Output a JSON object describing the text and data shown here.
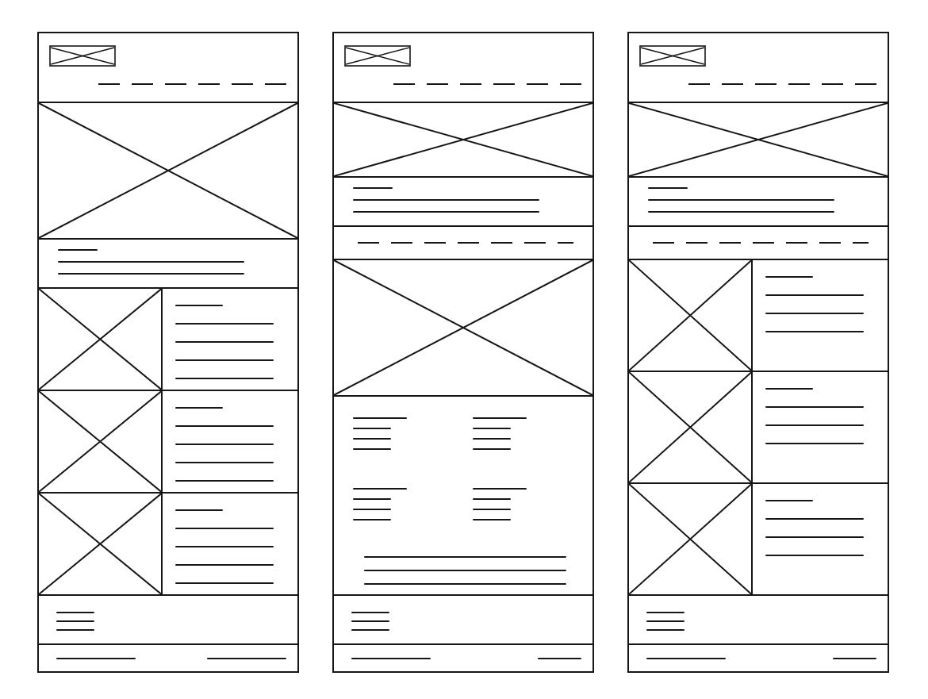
{
  "panels": [
    {
      "sections": [
        {
          "kind": "header"
        },
        {
          "kind": "hero"
        },
        {
          "kind": "text",
          "lines": [
            {
              "kind": "short"
            },
            {
              "kind": "long"
            },
            {
              "kind": "long"
            }
          ]
        },
        {
          "kind": "media",
          "lines": [
            {
              "kind": "short"
            },
            {
              "kind": "long"
            },
            {
              "kind": "long"
            },
            {
              "kind": "long"
            },
            {
              "kind": "long"
            }
          ]
        },
        {
          "kind": "media",
          "lines": [
            {
              "kind": "short"
            },
            {
              "kind": "long"
            },
            {
              "kind": "long"
            },
            {
              "kind": "long"
            },
            {
              "kind": "long"
            }
          ]
        },
        {
          "kind": "media",
          "lines": [
            {
              "kind": "short"
            },
            {
              "kind": "long"
            },
            {
              "kind": "long"
            },
            {
              "kind": "long"
            },
            {
              "kind": "long"
            }
          ]
        },
        {
          "kind": "footer",
          "lines": [
            {
              "kind": "short"
            },
            {
              "kind": "short"
            },
            {
              "kind": "short"
            }
          ]
        },
        {
          "kind": "bottom-bar",
          "lines": [
            {
              "kind": "long"
            },
            {
              "kind": "long"
            }
          ]
        }
      ]
    },
    {
      "sections": [
        {
          "kind": "header"
        },
        {
          "kind": "banner"
        },
        {
          "kind": "text",
          "lines": [
            {
              "kind": "short"
            },
            {
              "kind": "long"
            },
            {
              "kind": "long"
            }
          ]
        },
        {
          "kind": "nav"
        },
        {
          "kind": "hero"
        },
        {
          "kind": "columns",
          "groups": [
            {
              "lines": [
                {
                  "kind": "long"
                },
                {
                  "kind": "short"
                },
                {
                  "kind": "short"
                },
                {
                  "kind": "short"
                }
              ]
            },
            {
              "lines": [
                {
                  "kind": "long"
                },
                {
                  "kind": "short"
                },
                {
                  "kind": "short"
                },
                {
                  "kind": "short"
                }
              ]
            },
            {
              "lines": [
                {
                  "kind": "long"
                },
                {
                  "kind": "short"
                },
                {
                  "kind": "short"
                },
                {
                  "kind": "short"
                }
              ]
            },
            {
              "lines": [
                {
                  "kind": "long"
                },
                {
                  "kind": "short"
                },
                {
                  "kind": "short"
                },
                {
                  "kind": "short"
                }
              ]
            }
          ],
          "lines": [
            {
              "kind": "long"
            },
            {
              "kind": "long"
            },
            {
              "kind": "long"
            }
          ]
        },
        {
          "kind": "footer",
          "lines": [
            {
              "kind": "short"
            },
            {
              "kind": "short"
            },
            {
              "kind": "short"
            }
          ]
        },
        {
          "kind": "bottom-bar",
          "lines": [
            {
              "kind": "long"
            },
            {
              "kind": "short"
            }
          ]
        }
      ]
    },
    {
      "sections": [
        {
          "kind": "header"
        },
        {
          "kind": "banner"
        },
        {
          "kind": "text",
          "lines": [
            {
              "kind": "short"
            },
            {
              "kind": "long"
            },
            {
              "kind": "long"
            }
          ]
        },
        {
          "kind": "nav"
        },
        {
          "kind": "media",
          "lines": [
            {
              "kind": "short"
            },
            {
              "kind": "long"
            },
            {
              "kind": "long"
            },
            {
              "kind": "long"
            }
          ]
        },
        {
          "kind": "media",
          "lines": [
            {
              "kind": "short"
            },
            {
              "kind": "long"
            },
            {
              "kind": "long"
            },
            {
              "kind": "long"
            }
          ]
        },
        {
          "kind": "media",
          "lines": [
            {
              "kind": "short"
            },
            {
              "kind": "long"
            },
            {
              "kind": "long"
            },
            {
              "kind": "long"
            }
          ]
        },
        {
          "kind": "footer",
          "lines": [
            {
              "kind": "short"
            },
            {
              "kind": "short"
            },
            {
              "kind": "short"
            }
          ]
        },
        {
          "kind": "bottom-bar",
          "lines": [
            {
              "kind": "long"
            },
            {
              "kind": "short"
            }
          ]
        }
      ]
    }
  ]
}
